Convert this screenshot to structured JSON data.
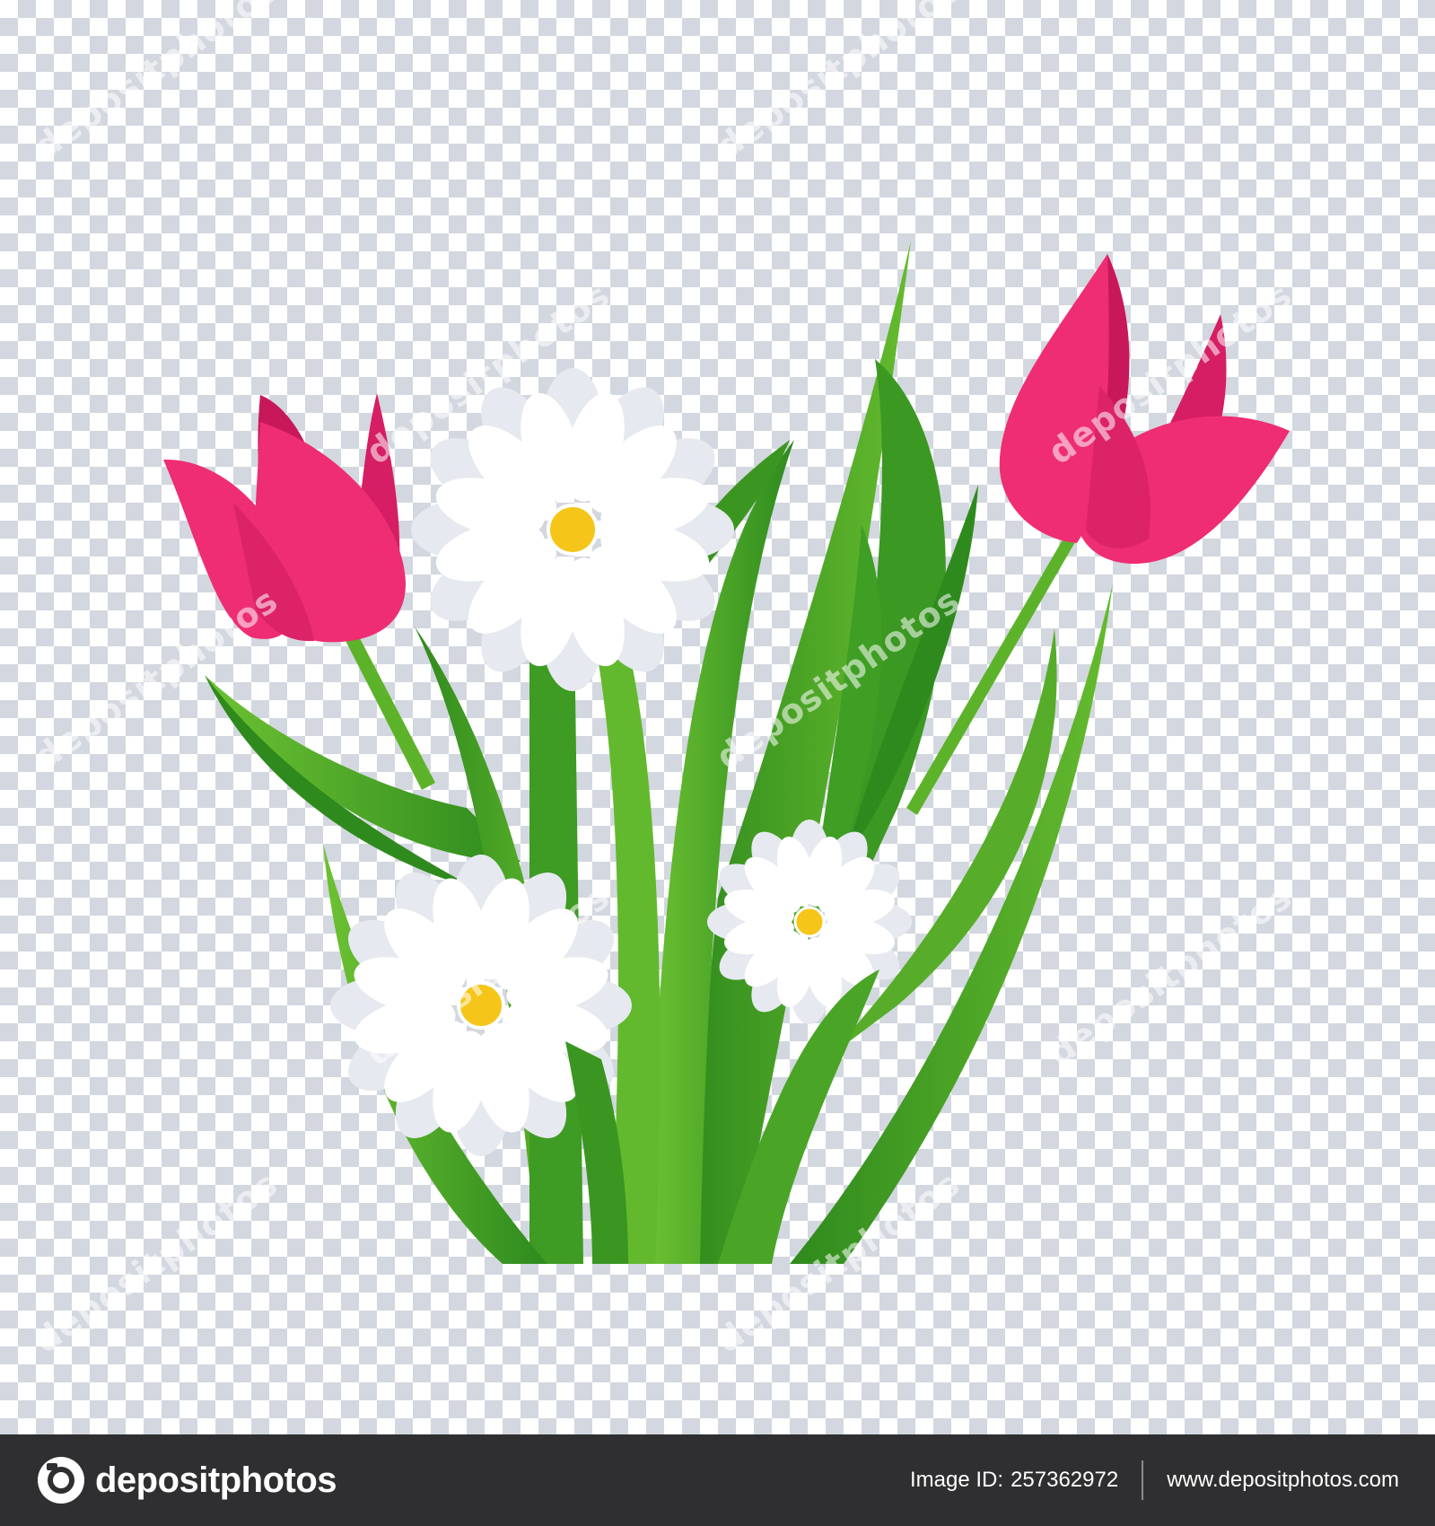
{
  "watermark": {
    "text": "depositphotos"
  },
  "footer": {
    "brand": "depositphotos",
    "image_id_label": "Image ID:",
    "image_id": "257362972",
    "website": "www.depositphotos.com"
  },
  "colors": {
    "checker_light": "#ffffff",
    "checker_dark": "#d3d7df",
    "tulip_main": "#ee2d73",
    "tulip_dark": "#c8185a",
    "leaf_light": "#5fb82b",
    "leaf_dark": "#2f8a1d",
    "daisy_petal": "#ffffff",
    "daisy_shade": "#e6e9ef",
    "daisy_center": "#f5c519",
    "footer_bg": "#2f2f31"
  },
  "icons": [
    "camera-logo-icon"
  ]
}
